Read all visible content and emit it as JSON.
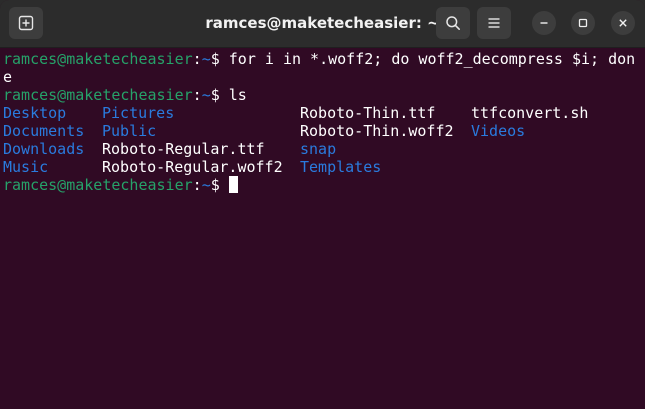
{
  "window": {
    "title": "ramces@maketecheasier: ~",
    "icons": {
      "new_tab": "new-tab-icon",
      "search": "search-icon",
      "menu": "hamburger-menu-icon",
      "minimize": "minimize-icon",
      "maximize": "maximize-icon",
      "close": "close-icon"
    }
  },
  "colors": {
    "background": "#300a24",
    "prompt_user": "#26a269",
    "directory": "#2a7bde",
    "text": "#ffffff",
    "titlebar": "#2c2c2c"
  },
  "terminal": {
    "prompt": {
      "user_host": "ramces@maketecheasier",
      "colon": ":",
      "path": "~",
      "symbol": "$"
    },
    "commands": [
      " for i in *.woff2; do woff2_decompress $i; done",
      " ls",
      " "
    ],
    "ls_rows": [
      [
        {
          "text": "Desktop",
          "kind": "dir"
        },
        {
          "text": "Pictures",
          "kind": "dir"
        },
        {
          "text": "Roboto-Thin.ttf",
          "kind": "file"
        },
        {
          "text": "ttfconvert.sh",
          "kind": "file"
        }
      ],
      [
        {
          "text": "Documents",
          "kind": "dir"
        },
        {
          "text": "Public",
          "kind": "dir"
        },
        {
          "text": "Roboto-Thin.woff2",
          "kind": "file"
        },
        {
          "text": "Videos",
          "kind": "dir"
        }
      ],
      [
        {
          "text": "Downloads",
          "kind": "dir"
        },
        {
          "text": "Roboto-Regular.ttf",
          "kind": "file"
        },
        {
          "text": "snap",
          "kind": "dir"
        },
        {
          "text": "",
          "kind": "file"
        }
      ],
      [
        {
          "text": "Music",
          "kind": "dir"
        },
        {
          "text": "Roboto-Regular.woff2",
          "kind": "file"
        },
        {
          "text": "Templates",
          "kind": "dir"
        },
        {
          "text": "",
          "kind": "file"
        }
      ]
    ]
  }
}
